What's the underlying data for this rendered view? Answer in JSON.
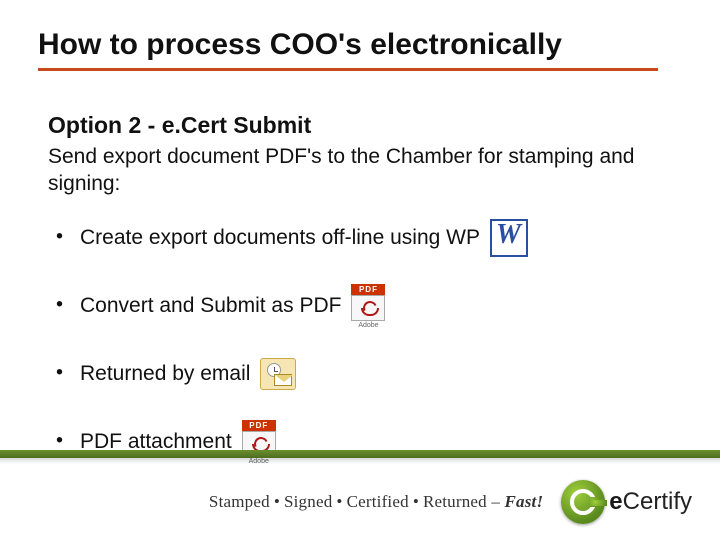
{
  "title": "How to process COO's electronically",
  "subtitle": "Option 2 - e.Cert Submit",
  "intro": "Send export document PDF's to the Chamber for stamping and signing:",
  "bullets": [
    {
      "text": "Create export documents off-line using WP",
      "icon": "word"
    },
    {
      "text": "Convert and Submit as PDF",
      "icon": "adobe"
    },
    {
      "text": "Returned by email",
      "icon": "outlook"
    },
    {
      "text": "PDF attachment",
      "icon": "adobe"
    }
  ],
  "icons": {
    "adobe_badge": "PDF",
    "adobe_label": "Adobe"
  },
  "footer": {
    "tagline_parts": [
      "Stamped",
      "Signed",
      "Certified",
      "Returned"
    ],
    "tagline_tail": "Fast!",
    "brand_prefix": "e",
    "brand_word": "Certify"
  },
  "colors": {
    "rule": "#c84a1b",
    "band": "#5a8a1e"
  }
}
